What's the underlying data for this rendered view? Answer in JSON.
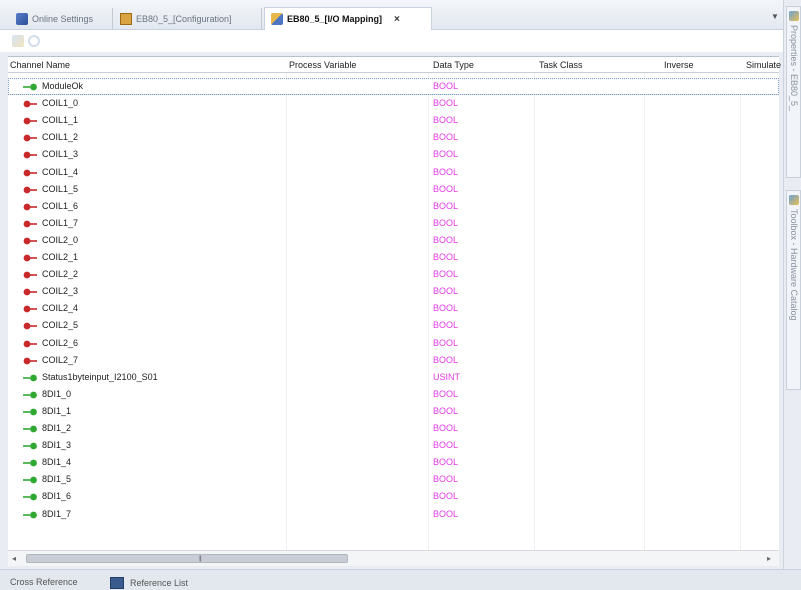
{
  "tabs": [
    {
      "label": "Online Settings",
      "icon": "online-settings-icon",
      "active": false
    },
    {
      "label": "EB80_5_[Configuration]",
      "icon": "configuration-icon",
      "active": false
    },
    {
      "label": "EB80_5_[I/O Mapping]",
      "icon": "io-mapping-icon",
      "active": true
    }
  ],
  "tab_close": "×",
  "tab_dropdown": "▼",
  "columns": [
    "Channel Name",
    "Process Variable",
    "Data Type",
    "Task Class",
    "Inverse",
    "Simulate"
  ],
  "rows": [
    {
      "name": "ModuleOk",
      "type": "BOOL",
      "dir": "in"
    },
    {
      "name": "COIL1_0",
      "type": "BOOL",
      "dir": "out"
    },
    {
      "name": "COIL1_1",
      "type": "BOOL",
      "dir": "out"
    },
    {
      "name": "COIL1_2",
      "type": "BOOL",
      "dir": "out"
    },
    {
      "name": "COIL1_3",
      "type": "BOOL",
      "dir": "out"
    },
    {
      "name": "COIL1_4",
      "type": "BOOL",
      "dir": "out"
    },
    {
      "name": "COIL1_5",
      "type": "BOOL",
      "dir": "out"
    },
    {
      "name": "COIL1_6",
      "type": "BOOL",
      "dir": "out"
    },
    {
      "name": "COIL1_7",
      "type": "BOOL",
      "dir": "out"
    },
    {
      "name": "COIL2_0",
      "type": "BOOL",
      "dir": "out"
    },
    {
      "name": "COIL2_1",
      "type": "BOOL",
      "dir": "out"
    },
    {
      "name": "COIL2_2",
      "type": "BOOL",
      "dir": "out"
    },
    {
      "name": "COIL2_3",
      "type": "BOOL",
      "dir": "out"
    },
    {
      "name": "COIL2_4",
      "type": "BOOL",
      "dir": "out"
    },
    {
      "name": "COIL2_5",
      "type": "BOOL",
      "dir": "out"
    },
    {
      "name": "COIL2_6",
      "type": "BOOL",
      "dir": "out"
    },
    {
      "name": "COIL2_7",
      "type": "BOOL",
      "dir": "out"
    },
    {
      "name": "Status1byteinput_I2100_S01",
      "type": "USINT",
      "dir": "in"
    },
    {
      "name": "8DI1_0",
      "type": "BOOL",
      "dir": "in"
    },
    {
      "name": "8DI1_1",
      "type": "BOOL",
      "dir": "in"
    },
    {
      "name": "8DI1_2",
      "type": "BOOL",
      "dir": "in"
    },
    {
      "name": "8DI1_3",
      "type": "BOOL",
      "dir": "in"
    },
    {
      "name": "8DI1_4",
      "type": "BOOL",
      "dir": "in"
    },
    {
      "name": "8DI1_5",
      "type": "BOOL",
      "dir": "in"
    },
    {
      "name": "8DI1_6",
      "type": "BOOL",
      "dir": "in"
    },
    {
      "name": "8DI1_7",
      "type": "BOOL",
      "dir": "in"
    }
  ],
  "bottom_tabs": [
    "Cross Reference",
    "Reference List"
  ],
  "side_panels": [
    "Properties - EB80_5_",
    "Toolbox - Hardware Catalog"
  ],
  "scroll": {
    "left": "◂",
    "right": "▸",
    "grip": "|||"
  },
  "colors": {
    "data_type": "#e23ae6",
    "input_icon": "#2fa832",
    "output_icon": "#c8282a"
  }
}
